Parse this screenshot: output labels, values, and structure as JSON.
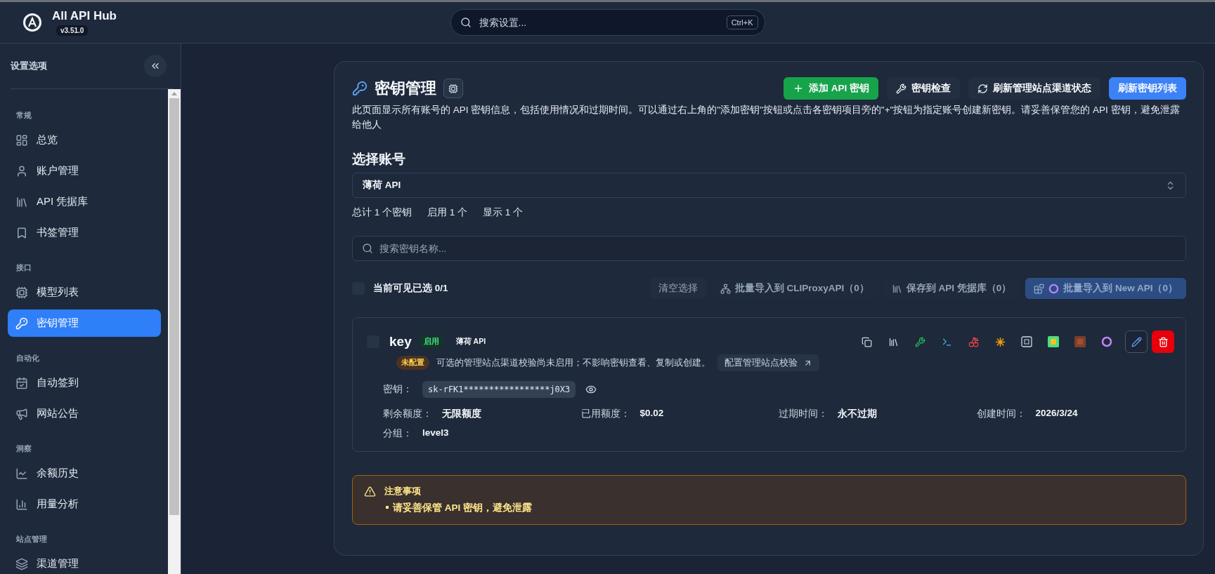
{
  "app": {
    "name": "All API Hub",
    "version": "v3.51.0"
  },
  "search": {
    "placeholder": "搜索设置...",
    "shortcut": "Ctrl+K"
  },
  "sidebar": {
    "title": "设置选项",
    "sections": [
      {
        "label": "常规",
        "items": [
          {
            "label": "总览",
            "selected": false
          },
          {
            "label": "账户管理",
            "selected": false
          },
          {
            "label": "API 凭据库",
            "selected": false
          },
          {
            "label": "书签管理",
            "selected": false
          }
        ]
      },
      {
        "label": "接口",
        "items": [
          {
            "label": "模型列表",
            "selected": false
          },
          {
            "label": "密钥管理",
            "selected": true
          }
        ]
      },
      {
        "label": "自动化",
        "items": [
          {
            "label": "自动签到",
            "selected": false
          },
          {
            "label": "网站公告",
            "selected": false
          }
        ]
      },
      {
        "label": "洞察",
        "items": [
          {
            "label": "余额历史",
            "selected": false
          },
          {
            "label": "用量分析",
            "selected": false
          }
        ]
      },
      {
        "label": "站点管理",
        "items": [
          {
            "label": "渠道管理",
            "selected": false
          }
        ]
      }
    ]
  },
  "page": {
    "title": "密钥管理",
    "actions": [
      {
        "label": "添加 API 密钥",
        "kind": "add"
      },
      {
        "label": "密钥检查",
        "kind": "check"
      },
      {
        "label": "刷新管理站点渠道状态",
        "kind": "refresh"
      },
      {
        "label": "刷新密钥列表",
        "kind": "primary"
      }
    ],
    "description": "此页面显示所有账号的 API 密钥信息，包括使用情况和过期时间。可以通过右上角的\"添加密钥\"按钮或点击各密钥项目旁的\"+\"按钮为指定账号创建新密钥。请妥善保管您的 API 密钥，避免泄露给他人",
    "account_heading": "选择账号",
    "account_select": "薄荷 API",
    "stats": [
      "总计 1 个密钥",
      "启用 1 个",
      "显示 1 个"
    ],
    "key_search": {
      "placeholder": "搜索密钥名称..."
    }
  },
  "selection": {
    "checked": false,
    "label": "当前可见已选 0/1",
    "actions": [
      {
        "label": "清空选择",
        "kind": "plain"
      },
      {
        "label": "批量导入到 CLIProxyAPI（0）",
        "kind": "cliproxy"
      },
      {
        "label": "保存到 API 凭据库（0）",
        "kind": "vault"
      },
      {
        "label": "批量导入到 New API（0）",
        "kind": "newapi"
      }
    ]
  },
  "keys": [
    {
      "name": "key",
      "checked": false,
      "status": "启用",
      "account": "薄荷 API",
      "check_badge": "未配置",
      "check_note": "可选的管理站点渠道校验尚未启用；不影响密钥查看、复制或创建。",
      "check_link": "配置管理站点校验",
      "secret_label": "密钥：",
      "secret": "sk-rFK1*****************j0X3",
      "fields": [
        {
          "label": "剩余额度：",
          "value": "无限额度"
        },
        {
          "label": "已用额度：",
          "value": "$0.02"
        },
        {
          "label": "过期时间：",
          "value": "永不过期"
        },
        {
          "label": "创建时间：",
          "value": "2026/3/24"
        },
        {
          "label": "分组：",
          "value": "level3"
        }
      ]
    }
  ],
  "notice": {
    "title": "注意事项",
    "items": [
      "请妥善保管 API 密钥，避免泄露"
    ]
  }
}
